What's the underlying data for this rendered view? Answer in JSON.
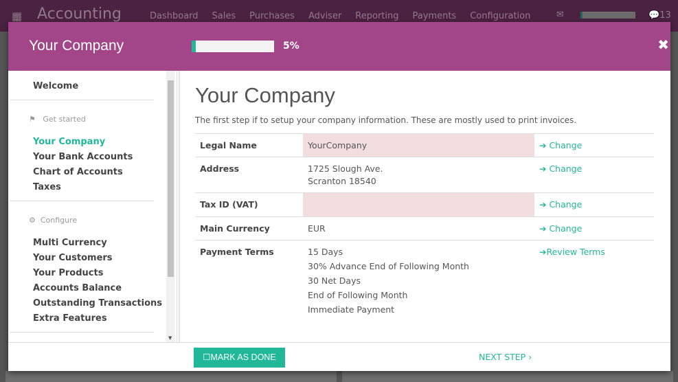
{
  "topbar": {
    "app_name": "Accounting",
    "menu": [
      "Dashboard",
      "Sales",
      "Purchases",
      "Adviser",
      "Reporting",
      "Payments",
      "Configuration"
    ],
    "chat_count": "13"
  },
  "modal": {
    "title": "Your Company",
    "progress_percent": 5,
    "progress_label": "5%"
  },
  "sidebar": {
    "welcome": "Welcome",
    "section1": "Get started",
    "items1": [
      "Your Company",
      "Your Bank Accounts",
      "Chart of Accounts",
      "Taxes"
    ],
    "section2": "Configure",
    "items2": [
      "Multi Currency",
      "Your Customers",
      "Your Products",
      "Accounts Balance",
      "Outstanding Transactions",
      "Extra Features"
    ]
  },
  "content": {
    "title": "Your Company",
    "description": "The first step if to setup your company information. These are mostly used to print invoices.",
    "rows": [
      {
        "label": "Legal Name",
        "value": "YourCompany",
        "action": "Change"
      },
      {
        "label": "Address",
        "value": "1725 Slough Ave.",
        "value2": "Scranton 18540",
        "action": "Change"
      },
      {
        "label": "Tax ID (VAT)",
        "value": "",
        "action": "Change"
      },
      {
        "label": "Main Currency",
        "value": "EUR",
        "action": "Change"
      },
      {
        "label": "Payment Terms",
        "terms": [
          "15 Days",
          "30% Advance End of Following Month",
          "30 Net Days",
          "End of Following Month",
          "Immediate Payment"
        ],
        "action": "Review Terms"
      }
    ]
  },
  "footer": {
    "mark_done": "MARK AS DONE",
    "next_step": "NEXT STEP"
  },
  "colors": {
    "header": "#a24689",
    "accent": "#21b799",
    "required": "#f2dede"
  }
}
